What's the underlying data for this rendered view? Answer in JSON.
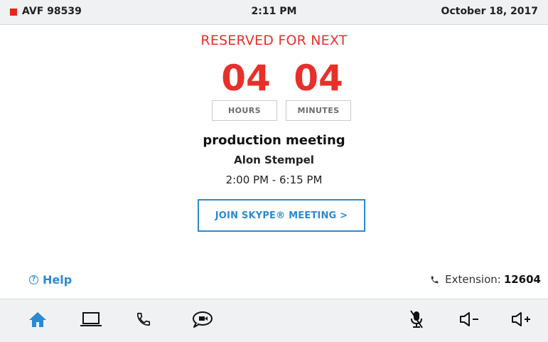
{
  "status_bar": {
    "room_id": "AVF 98539",
    "time": "2:11 PM",
    "date": "October 18, 2017",
    "status_color": "#e4261c"
  },
  "reservation": {
    "heading": "RESERVED FOR NEXT",
    "hours_value": "04",
    "hours_label": "HOURS",
    "minutes_value": "04",
    "minutes_label": "MINUTES"
  },
  "meeting": {
    "title": "production meeting",
    "organizer": "Alon Stempel",
    "time_range": "2:00 PM - 6:15 PM",
    "join_button_label": "JOIN SKYPE® MEETING >"
  },
  "footer": {
    "help_label": "Help",
    "help_icon": "question-circle-icon",
    "extension_label": "Extension:",
    "extension_number": "12604",
    "extension_icon": "phone-icon"
  },
  "nav": {
    "left": [
      "home-icon",
      "laptop-icon",
      "phone-icon",
      "chat-video-icon"
    ],
    "right": [
      "mic-muted-icon",
      "volume-down-icon",
      "volume-up-icon"
    ],
    "active": "home-icon"
  },
  "colors": {
    "accent": "#2a8ad4",
    "alert": "#e8302a",
    "bar_bg": "#f0f1f2"
  }
}
